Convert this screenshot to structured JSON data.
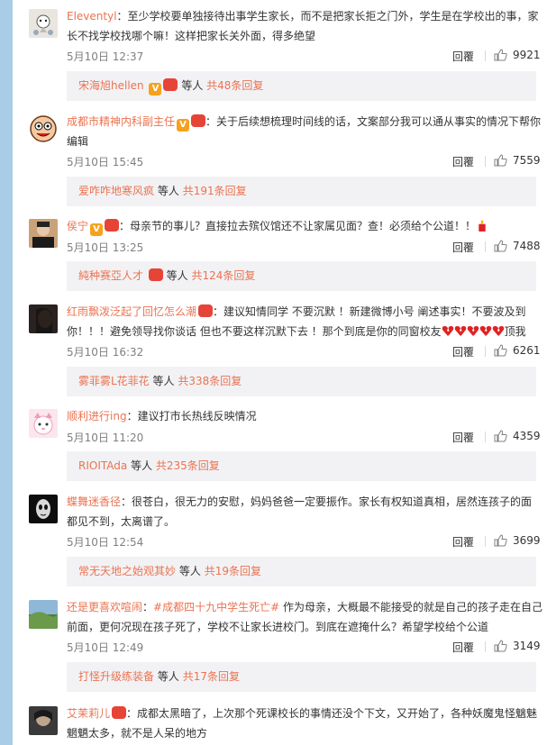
{
  "comments": [
    {
      "user": "Eleventyl",
      "text": "：至少学校要单独接待出事学生家长，而不是把家长拒之门外，学生是在学校出的事，家长不找学校找哪个嘛！这样把家长关外面，得多绝望",
      "time": "5月10日 12:37",
      "reply": "回覆",
      "likes": "9921",
      "sub": {
        "user": "宋海旭hellen",
        "mid": "等人",
        "count": "共48条回复"
      }
    },
    {
      "user": "成都市精神内科副主任",
      "text": "：关于后续想梳理时间线的话，文案部分我可以通从事实的情况下帮你编辑",
      "time": "5月10日 15:45",
      "reply": "回覆",
      "likes": "7559",
      "sub": {
        "user": "爱咋咋地寒风疯",
        "mid": "等人",
        "count": "共191条回复"
      }
    },
    {
      "user": "侯宁",
      "text": "：母亲节的事儿？直接拉去殡仪馆还不让家属见面？查！必须给个公道！！",
      "time": "5月10日 13:25",
      "reply": "回覆",
      "likes": "7488",
      "sub": {
        "user": "純种赛亞人才",
        "mid": "等人",
        "count": "共124条回复"
      }
    },
    {
      "user": "红雨飘泼泛起了回忆怎么潮",
      "text_a": "：建议知情同学 不要沉默 ！新建微博小号 阐述事实！不要波及到你！！！避免领导找你谈话 但也不要这样沉默下去 ！那个到底是你的同窗校友",
      "text_b": "顶我",
      "time": "5月10日 16:32",
      "reply": "回覆",
      "likes": "6261",
      "sub": {
        "user": "雾菲雾L花菲花",
        "mid": "等人",
        "count": "共338条回复"
      }
    },
    {
      "user": "顺利进行ing",
      "text": "：建议打市长热线反映情况",
      "time": "5月10日 11:20",
      "reply": "回覆",
      "likes": "4359",
      "sub": {
        "user": "RIOITAda",
        "mid": "等人",
        "count": "共235条回复"
      }
    },
    {
      "user": "蝶舞迷香径",
      "text": "：很苍白，很无力的安慰，妈妈爸爸一定要振作。家长有权知道真相，居然连孩子的面都见不到，太离谱了。",
      "time": "5月10日 12:54",
      "reply": "回覆",
      "likes": "3699",
      "sub": {
        "user": "常无天地之始观其妙",
        "mid": "等人",
        "count": "共19条回复"
      }
    },
    {
      "user": "还是更喜欢喧闹",
      "tag": "#成都四十九中学生死亡#",
      "text": " 作为母亲，大概最不能接受的就是自己的孩子走在自己前面，更何况现在孩子死了，学校不让家长进校门。到底在遮掩什么？希望学校给个公道",
      "time": "5月10日 12:49",
      "reply": "回覆",
      "likes": "3149",
      "sub": {
        "user": "打怪升级练装备",
        "mid": "等人",
        "count": "共17条回复"
      }
    },
    {
      "user": "艾茉莉儿",
      "text": "：成都太黑暗了，上次那个死课校长的事情还没个下文，又开始了，各种妖魔鬼怪魑魅魍魉太多，就不是人呆的地方"
    }
  ]
}
